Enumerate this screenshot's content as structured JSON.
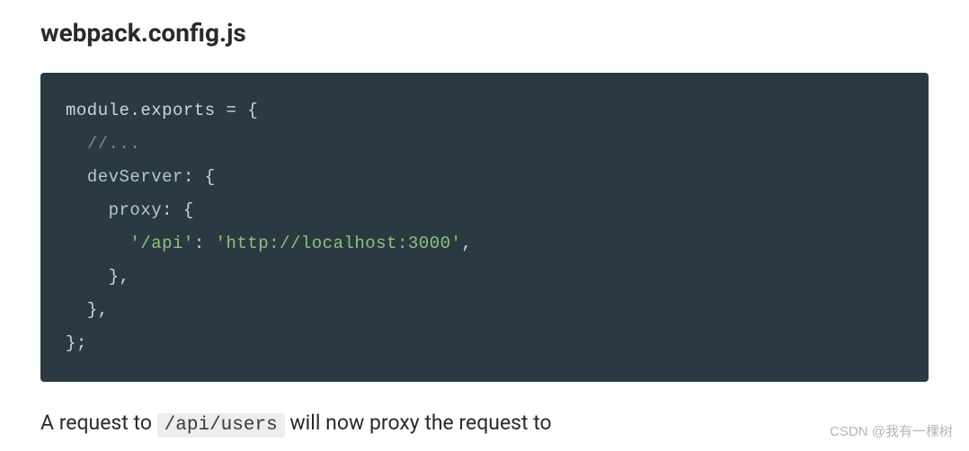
{
  "heading": "webpack.config.js",
  "code": {
    "l1_module": "module",
    "l1_exports": ".exports",
    "l1_assign": " = {",
    "l2_indent": "  ",
    "l2_comment": "//...",
    "l3_indent": "  ",
    "l3_key": "devServer",
    "l3_colon_brace": ": {",
    "l4_indent": "    ",
    "l4_key": "proxy",
    "l4_colon_brace": ": {",
    "l5_indent": "      ",
    "l5_key": "'/api'",
    "l5_colon": ": ",
    "l5_value": "'http://localhost:3000'",
    "l5_comma": ",",
    "l6_indent": "    ",
    "l6_close": "},",
    "l7_indent": "  ",
    "l7_close": "},",
    "l8_close": "};"
  },
  "paragraph": {
    "before": "A request to ",
    "code": "/api/users",
    "after": " will now proxy the request to"
  },
  "watermark": "CSDN @我有一棵树"
}
